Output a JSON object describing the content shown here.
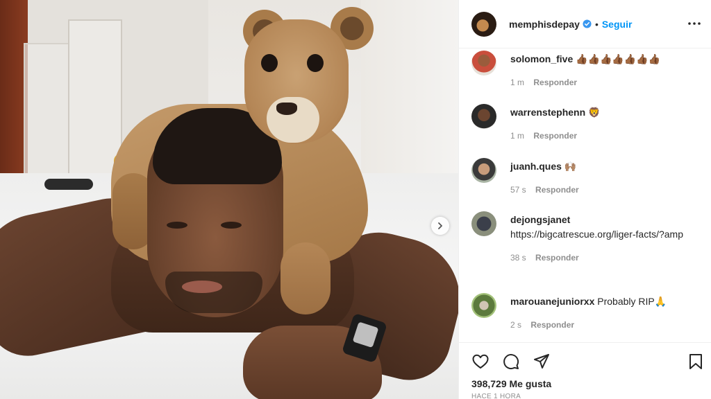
{
  "header": {
    "username": "memphisdepay",
    "separator": "•",
    "follow_label": "Seguir",
    "verified_icon": "verified-badge-icon",
    "more_icon": "more-options-icon"
  },
  "comments": [
    {
      "username": "solomon_five",
      "text": "👍🏾👍🏾👍🏾👍🏾👍🏾👍🏾👍🏾",
      "time": "1 m",
      "reply_label": "Responder"
    },
    {
      "username": "warrenstephenn",
      "text": "🦁",
      "time": "1 m",
      "reply_label": "Responder"
    },
    {
      "username": "juanh.ques",
      "text": "🙌🏽",
      "time": "57 s",
      "reply_label": "Responder"
    },
    {
      "username": "dejongsjanet",
      "text": "https://bigcatrescue.org/liger-facts/?amp",
      "time": "38 s",
      "reply_label": "Responder"
    },
    {
      "username": "marouanejuniorxx",
      "text": "Probably RIP🙏",
      "time": "2 s",
      "reply_label": "Responder"
    }
  ],
  "actions": {
    "icons": [
      "heart-icon",
      "comment-icon",
      "share-icon",
      "bookmark-icon"
    ],
    "likes": "398,729 Me gusta",
    "date": "HACE 1 HORA"
  },
  "photo": {
    "next_icon": "chevron-right-icon"
  },
  "colors": {
    "accent": "#0095f6",
    "text": "#262626",
    "muted": "#8e8e8e"
  }
}
